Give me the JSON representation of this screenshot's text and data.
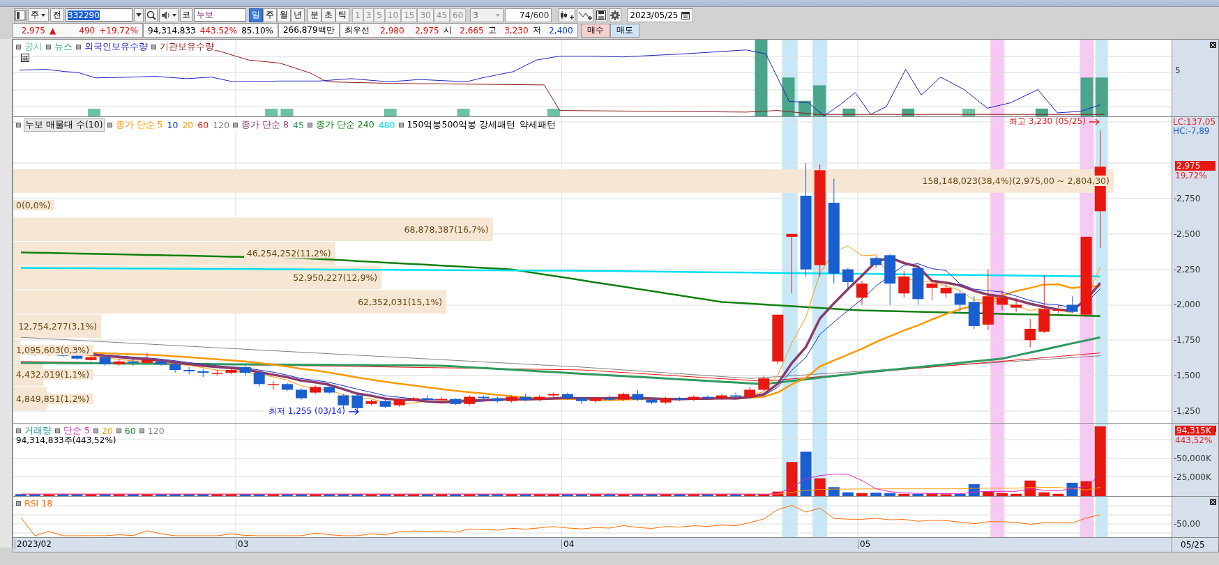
{
  "toolbar": {
    "market": "주",
    "prev": "전",
    "code": "332290",
    "code_prefix": "코",
    "name": "누보",
    "periods": [
      {
        "label": "일",
        "selected": true
      },
      {
        "label": "주",
        "selected": false
      },
      {
        "label": "월",
        "selected": false
      },
      {
        "label": "년",
        "selected": false
      }
    ],
    "intraday": [
      {
        "label": "분",
        "selected": false
      },
      {
        "label": "초",
        "selected": false
      },
      {
        "label": "틱",
        "selected": false
      }
    ],
    "multipliers": [
      {
        "label": "1",
        "disabled": true
      },
      {
        "label": "3",
        "disabled": true
      },
      {
        "label": "5",
        "disabled": true
      },
      {
        "label": "10",
        "disabled": true
      },
      {
        "label": "15",
        "disabled": true
      },
      {
        "label": "30",
        "disabled": true
      },
      {
        "label": "45",
        "disabled": true
      },
      {
        "label": "60",
        "disabled": true
      }
    ],
    "spin": "3",
    "count": "74",
    "count_max": "/600",
    "date": "2023/05/25"
  },
  "quote": {
    "price": "2,975",
    "direction": "▲",
    "change": "490",
    "change_pct": "+19.72%",
    "volume": "94,314,833",
    "volume_ratio": "443.52%",
    "turnover": "85.10%",
    "amount": "266,879백만",
    "best_label": "최우선",
    "ask": "2,980",
    "bid": "2,975",
    "open_label": "시",
    "open": "2,665",
    "high_label": "고",
    "high": "3,230",
    "low_label": "저",
    "low": "2,400",
    "buy_button": "매수",
    "sell_button": "매도"
  },
  "holdings_panel": {
    "legend": [
      {
        "label": "공시",
        "color": "#6cc3a4"
      },
      {
        "label": "뉴스",
        "color": "#2ea878"
      },
      {
        "label": "외국인보유수량",
        "color": "#2020c0"
      },
      {
        "label": "기관보유수량",
        "color": "#8b1a1a"
      }
    ],
    "axis_ticks": [
      "5"
    ]
  },
  "price_panel": {
    "legend": [
      {
        "items": [
          {
            "label": "누보 매물대 수(10)",
            "color": "#000000",
            "boxed": true
          }
        ]
      },
      {
        "items": [
          {
            "label": "종가 단순 5",
            "color": "#ff9900",
            "boxed": false
          },
          {
            "label": "10",
            "color": "#1030d0",
            "boxed": false
          },
          {
            "label": "20",
            "color": "#ff9900",
            "boxed": false
          },
          {
            "label": "60",
            "color": "#ee1111",
            "boxed": false
          },
          {
            "label": "120",
            "color": "#808080",
            "boxed": false
          }
        ]
      },
      {
        "items": [
          {
            "label": "종가 단순 8",
            "color": "#8b3a6b",
            "boxed": false
          },
          {
            "label": "45",
            "color": "#2e9a5e",
            "boxed": false
          }
        ]
      },
      {
        "items": [
          {
            "label": "종가 단순 240",
            "color": "#108010",
            "boxed": false
          },
          {
            "label": "480",
            "color": "#00e0f0",
            "boxed": false
          }
        ]
      },
      {
        "items": [
          {
            "label": "150억봉500억봉 강세패턴",
            "boxed": false
          },
          {
            "label": "약세패턴",
            "boxed": false
          }
        ]
      }
    ],
    "volume_profile": [
      {
        "label": "158,148,023(38,4%)(2,975,00 ~ 2,804,30)",
        "level": 0.95
      },
      {
        "label": "0(0,0%)",
        "level": 0
      },
      {
        "label": "68,878,387(16,7%)",
        "level": 0.414
      },
      {
        "label": "46,254,252(11,2%)",
        "level": 0.278
      },
      {
        "label": "52,950,227(12,9%)",
        "level": 0.318
      },
      {
        "label": "62,352,031(15,1%)",
        "level": 0.374
      },
      {
        "label": "12,754,277(3,1%)",
        "level": 0.076
      },
      {
        "label": "1,095,603(0,3%)",
        "level": 0.006
      },
      {
        "label": "4,432,019(1,1%)",
        "level": 0.026
      },
      {
        "label": "4,849,851(1,2%)",
        "level": 0.029
      }
    ],
    "high_note": "최고 3,230 (05/25)",
    "low_note": "최저 1,255 (03/14)",
    "axis": {
      "indicators": [
        {
          "label": "LC:137,05",
          "color": "#e02020"
        },
        {
          "label": "HC:-7,89",
          "color": "#2060d0"
        }
      ],
      "current_tag": "2,975",
      "current_pct": "19,72%",
      "ticks": [
        "2,750",
        "2,500",
        "2,250",
        "2,000",
        "1,750",
        "1,500",
        "1,250"
      ]
    }
  },
  "volume_panel": {
    "legend": [
      {
        "label": "거래량",
        "color": "#1a9a9a"
      },
      {
        "label": "단순 5",
        "color": "#e020c0"
      },
      {
        "label": "20",
        "color": "#ff9900"
      },
      {
        "label": "60",
        "color": "#109030"
      },
      {
        "label": "120",
        "color": "#808080"
      }
    ],
    "total": "94,314,833주(443,52%)",
    "axis": {
      "current_tag": "94,315K",
      "current_pct": "443,52%",
      "ticks": [
        "50,000K",
        "25,000K"
      ]
    }
  },
  "rsi_panel": {
    "legend": [
      {
        "label": "RSI 18",
        "color": "#ff6a00"
      }
    ],
    "axis_ticks": [
      "50,00"
    ]
  },
  "x_axis": {
    "labels": [
      "2023/02",
      "03",
      "04",
      "05"
    ],
    "end_label": "05/25"
  }
}
